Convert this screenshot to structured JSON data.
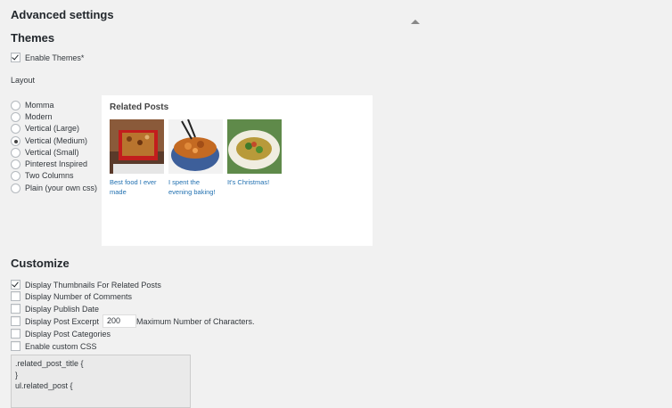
{
  "section": {
    "title": "Advanced settings"
  },
  "themes": {
    "title": "Themes",
    "enable_label": "Enable Themes*",
    "layout_label": "Layout",
    "layouts": [
      {
        "label": "Momma",
        "checked": false
      },
      {
        "label": "Modern",
        "checked": false
      },
      {
        "label": "Vertical (Large)",
        "checked": false
      },
      {
        "label": "Vertical (Medium)",
        "checked": true
      },
      {
        "label": "Vertical (Small)",
        "checked": false
      },
      {
        "label": "Pinterest Inspired",
        "checked": false
      },
      {
        "label": "Two Columns",
        "checked": false
      },
      {
        "label": "Plain (your own css)",
        "checked": false
      }
    ]
  },
  "preview": {
    "title": "Related Posts",
    "posts": [
      {
        "caption": "Best food I ever made"
      },
      {
        "caption": "I spent the evening baking!"
      },
      {
        "caption": "It's Christmas!"
      }
    ]
  },
  "customize": {
    "title": "Customize",
    "options": [
      {
        "label": "Display Thumbnails For Related Posts",
        "checked": true
      },
      {
        "label": "Display Number of Comments",
        "checked": false
      },
      {
        "label": "Display Publish Date",
        "checked": false
      },
      {
        "label": "Display Post Excerpt",
        "checked": false
      },
      {
        "label": "Display Post Categories",
        "checked": false
      },
      {
        "label": "Enable custom CSS",
        "checked": false
      }
    ],
    "excerpt_value": "200",
    "excerpt_suffix": "Maximum Number of Characters.",
    "css_lines": [
      ".related_post_title {",
      "}",
      "ul.related_post {"
    ]
  }
}
